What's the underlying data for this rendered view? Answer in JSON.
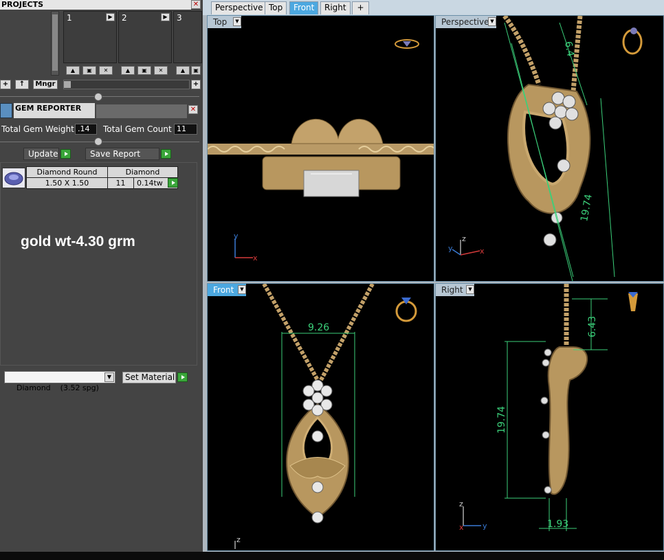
{
  "projects": {
    "title": "PROJECTS",
    "slots": [
      "1",
      "2",
      "3"
    ],
    "manager_label": "Mngr"
  },
  "gem_reporter": {
    "title": "GEM REPORTER",
    "total_weight_label": "Total Gem Weight",
    "total_weight_value": ".14",
    "total_count_label": "Total Gem Count",
    "total_count_value": "11",
    "update_label": "Update",
    "save_report_label": "Save Report",
    "table": {
      "headers": [
        "Diamond Round",
        "Diamond"
      ],
      "row": {
        "size": "1.50 X 1.50",
        "count": "11",
        "weight": "0.14tw"
      }
    },
    "note": "gold wt-4.30 grm",
    "material_value": "Diamond    (3.52 spg)",
    "set_material_label": "Set Material"
  },
  "tabs": [
    "Perspective",
    "Top",
    "Front",
    "Right",
    "+"
  ],
  "active_tab": "Front",
  "viewports": {
    "top": {
      "label": "Top"
    },
    "perspective": {
      "label": "Perspective",
      "dims": [
        "6.4",
        "19.74"
      ]
    },
    "front": {
      "label": "Front",
      "dims": [
        "9.26"
      ]
    },
    "right": {
      "label": "Right",
      "dims": [
        "6.43",
        "19.74",
        "1.93"
      ]
    }
  },
  "axes": {
    "x": "x",
    "y": "y",
    "z": "z"
  },
  "colors": {
    "gold": "#c8a56a",
    "dimension": "#3bd07a",
    "accent": "#4ca8e0"
  }
}
